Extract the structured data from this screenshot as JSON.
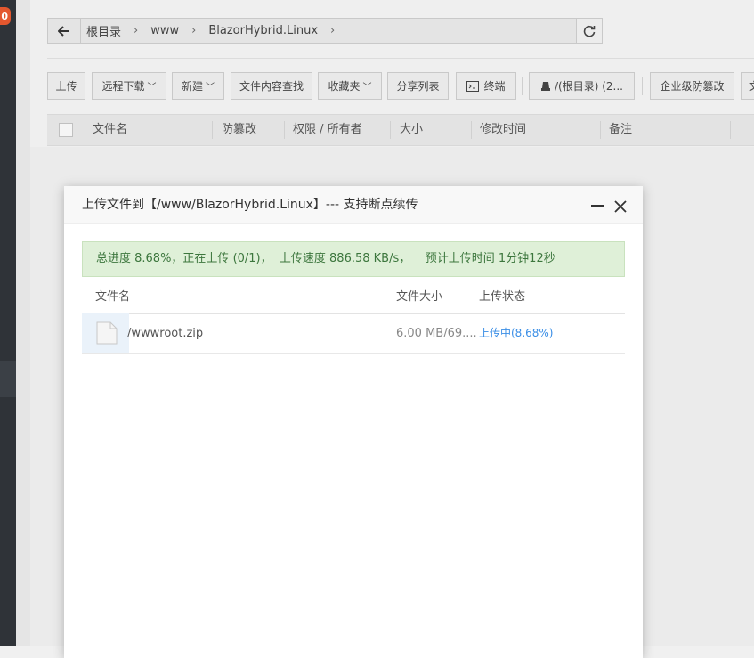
{
  "sidebar": {
    "badge": "0"
  },
  "breadcrumb": {
    "items": [
      "根目录",
      "www",
      "BlazorHybrid.Linux"
    ],
    "separator": "›"
  },
  "toolbar": {
    "upload": "上传",
    "remote_download": "远程下载",
    "new": "新建",
    "content_search": "文件内容查找",
    "favorites": "收藏夹",
    "share_list": "分享列表",
    "terminal": "终端",
    "disk": "/(根目录) (2...",
    "tamper": "企业级防篡改",
    "more": "文"
  },
  "table": {
    "columns": [
      "文件名",
      "防篡改",
      "权限 / 所有者",
      "大小",
      "修改时间",
      "备注"
    ]
  },
  "modal": {
    "title": "上传文件到【/www/BlazorHybrid.Linux】--- 支持断点续传",
    "progress_text": "总进度 8.68%，正在上传 (0/1)，  上传速度 886.58 KB/s，    预计上传时间 1分钟12秒",
    "progress_percent": 8.68,
    "file_columns": [
      "文件名",
      "文件大小",
      "上传状态"
    ],
    "files": [
      {
        "name": "/wwwroot.zip",
        "size": "6.00 MB/69....",
        "status": "上传中(8.68%)"
      }
    ]
  },
  "colors": {
    "sidebar": "#2f3338",
    "badge": "#e4572e",
    "progress_bg": "#dff0d8",
    "progress_text": "#3c763d",
    "status_link": "#3a8ee6"
  }
}
